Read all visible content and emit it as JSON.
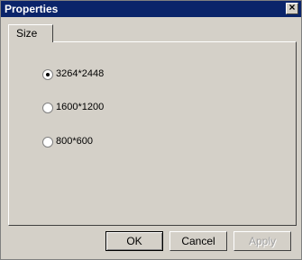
{
  "window": {
    "title": "Properties",
    "close_glyph": "×"
  },
  "tabs": [
    {
      "label": "Size"
    }
  ],
  "size_options": [
    {
      "label": "3264*2448",
      "selected": true
    },
    {
      "label": "1600*1200",
      "selected": false
    },
    {
      "label": "800*600",
      "selected": false
    }
  ],
  "buttons": {
    "ok": "OK",
    "cancel": "Cancel",
    "apply": "Apply"
  }
}
